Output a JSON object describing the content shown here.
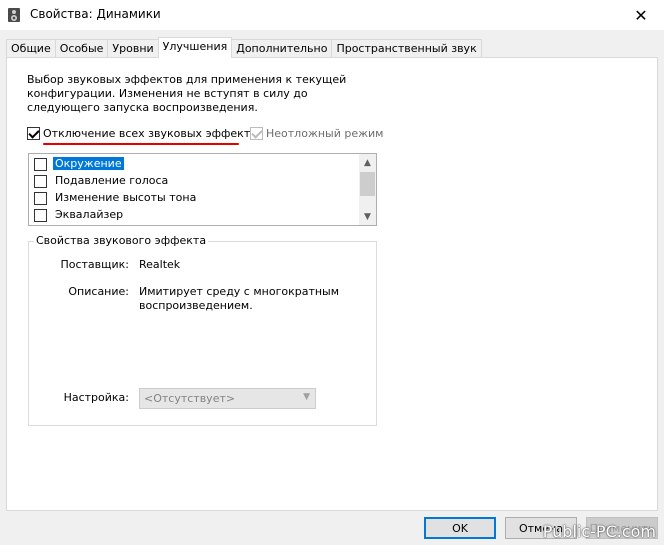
{
  "window": {
    "title": "Свойства: Динамики",
    "close_glyph": "✕"
  },
  "tabs": [
    {
      "label": "Общие"
    },
    {
      "label": "Особые"
    },
    {
      "label": "Уровни"
    },
    {
      "label": "Улучшения",
      "active": true
    },
    {
      "label": "Дополнительно"
    },
    {
      "label": "Пространственный звук"
    }
  ],
  "enhancements": {
    "description": "Выбор звуковых эффектов для применения к текущей конфигурации. Изменения не вступят в силу до следующего запуска воспроизведения.",
    "disable_all": {
      "label": "Отключение всех звуковых эффектов",
      "checked": true
    },
    "immediate_mode": {
      "label": "Неотложный режим",
      "checked": true,
      "disabled": true
    },
    "effects": [
      {
        "label": "Окружение",
        "checked": false,
        "selected": true
      },
      {
        "label": "Подавление голоса",
        "checked": false
      },
      {
        "label": "Изменение высоты тона",
        "checked": false
      },
      {
        "label": "Эквалайзер",
        "checked": false
      }
    ]
  },
  "effect_properties": {
    "group_title": "Свойства звукового эффекта",
    "provider_label": "Поставщик:",
    "provider_value": "Realtek",
    "description_label": "Описание:",
    "description_value_line1": "Имитирует среду с многократным",
    "description_value_line2": "воспроизведением.",
    "setting_label": "Настройка:",
    "setting_value": "<Отсутствует>"
  },
  "buttons": {
    "ok": "OK",
    "cancel": "Отмена",
    "apply": "Применить"
  },
  "watermark": "Public-PC.com",
  "colors": {
    "annotation_red": "#e50000",
    "selection_blue": "#0078d7"
  }
}
